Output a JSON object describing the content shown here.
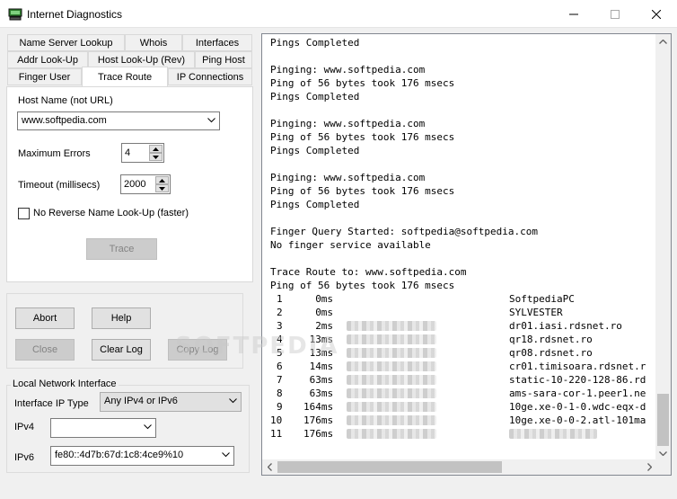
{
  "window": {
    "title": "Internet Diagnostics"
  },
  "tabs": {
    "row1": [
      "Name Server Lookup",
      "Whois",
      "Interfaces"
    ],
    "row2": [
      "Addr Look-Up",
      "Host Look-Up (Rev)",
      "Ping Host"
    ],
    "row3": [
      "Finger User",
      "Trace Route",
      "IP Connections"
    ],
    "active": "Trace Route"
  },
  "trace": {
    "host_label": "Host Name (not URL)",
    "host_value": "www.softpedia.com",
    "max_errors_label": "Maximum Errors",
    "max_errors_value": "4",
    "timeout_label": "Timeout (millisecs)",
    "timeout_value": "2000",
    "no_reverse_label": "No Reverse Name Look-Up (faster)",
    "trace_button": "Trace"
  },
  "buttons": {
    "abort": "Abort",
    "help": "Help",
    "close": "Close",
    "clear_log": "Clear Log",
    "copy_log": "Copy Log"
  },
  "network": {
    "group_title": "Local Network Interface",
    "ip_type_label": "Interface IP Type",
    "ip_type_value": "Any IPv4 or IPv6",
    "ipv4_label": "IPv4",
    "ipv4_value": "",
    "ipv6_label": "IPv6",
    "ipv6_value": "fe80::4d7b:67d:1c8:4ce9%10"
  },
  "log": {
    "lines": [
      "Pings Completed",
      "",
      "Pinging: www.softpedia.com",
      "Ping of 56 bytes took 176 msecs",
      "Pings Completed",
      "",
      "Pinging: www.softpedia.com",
      "Ping of 56 bytes took 176 msecs",
      "Pings Completed",
      "",
      "Pinging: www.softpedia.com",
      "Ping of 56 bytes took 176 msecs",
      "Pings Completed",
      "",
      "Finger Query Started: softpedia@softpedia.com",
      "No finger service available",
      "",
      "Trace Route to: www.softpedia.com",
      "Ping of 56 bytes took 176 msecs"
    ],
    "hops": [
      {
        "n": "1",
        "t": "0ms",
        "host": "SoftpediaPC"
      },
      {
        "n": "2",
        "t": "0ms",
        "host": "SYLVESTER"
      },
      {
        "n": "3",
        "t": "2ms",
        "host": "dr01.iasi.rdsnet.ro"
      },
      {
        "n": "4",
        "t": "13ms",
        "host": "qr18.rdsnet.ro"
      },
      {
        "n": "5",
        "t": "13ms",
        "host": "qr08.rdsnet.ro"
      },
      {
        "n": "6",
        "t": "14ms",
        "host": "cr01.timisoara.rdsnet.r"
      },
      {
        "n": "7",
        "t": "63ms",
        "host": "static-10-220-128-86.rd"
      },
      {
        "n": "8",
        "t": "63ms",
        "host": "ams-sara-cor-1.peer1.ne"
      },
      {
        "n": "9",
        "t": "164ms",
        "host": "10ge.xe-0-1-0.wdc-eqx-d"
      },
      {
        "n": "10",
        "t": "176ms",
        "host": "10ge.xe-0-0-2.atl-101ma"
      },
      {
        "n": "11",
        "t": "176ms",
        "host": ""
      }
    ]
  },
  "watermark": "SOFTPEDIA"
}
